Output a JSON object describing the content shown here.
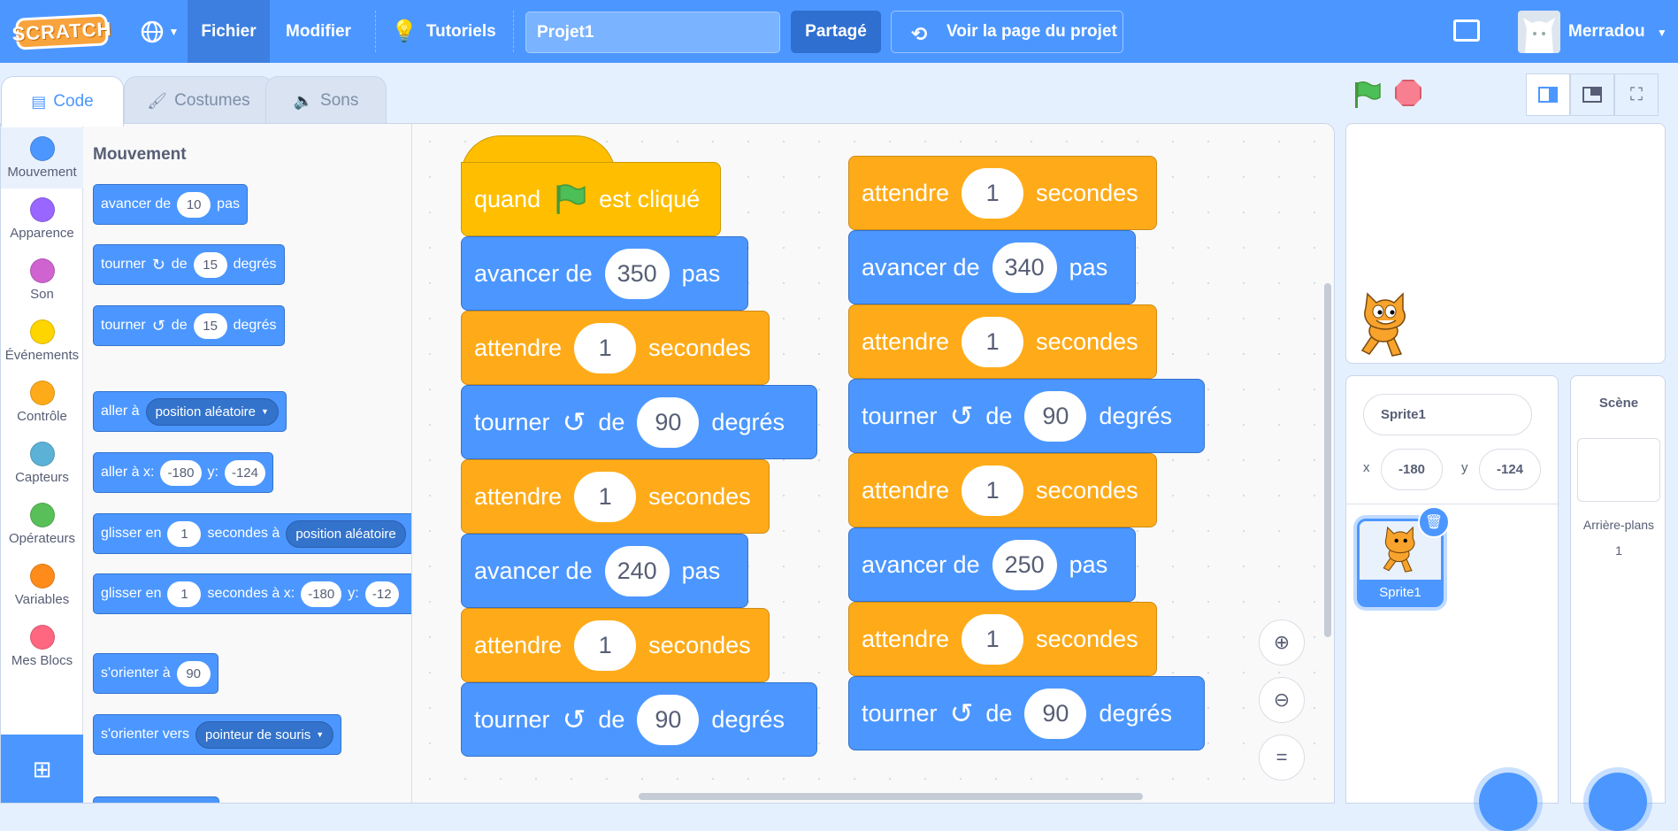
{
  "menu": {
    "logo": "SCRATCH",
    "file": "Fichier",
    "edit": "Modifier",
    "tutorials": "Tutoriels",
    "project_title": "Projet1",
    "share": "Partagé",
    "see_project": "Voir la page du projet",
    "username": "Merradou"
  },
  "tabs": {
    "code": "Code",
    "costumes": "Costumes",
    "sounds": "Sons"
  },
  "categories": [
    {
      "label": "Mouvement",
      "color": "#4c97ff"
    },
    {
      "label": "Apparence",
      "color": "#9966ff"
    },
    {
      "label": "Son",
      "color": "#cf63cf"
    },
    {
      "label": "Événements",
      "color": "#ffd500"
    },
    {
      "label": "Contrôle",
      "color": "#ffab19"
    },
    {
      "label": "Capteurs",
      "color": "#5cb1d6"
    },
    {
      "label": "Opérateurs",
      "color": "#59c059"
    },
    {
      "label": "Variables",
      "color": "#ff8c1a"
    },
    {
      "label": "Mes Blocs",
      "color": "#ff6680"
    }
  ],
  "palette": {
    "title": "Mouvement",
    "b1": {
      "t1": "avancer de",
      "v1": "10",
      "t2": "pas"
    },
    "b2": {
      "t1": "tourner",
      "t2": "de",
      "v1": "15",
      "t3": "degrés"
    },
    "b3": {
      "t1": "tourner",
      "t2": "de",
      "v1": "15",
      "t3": "degrés"
    },
    "b4": {
      "t1": "aller à",
      "d1": "position aléatoire"
    },
    "b5": {
      "t1": "aller à x:",
      "v1": "-180",
      "t2": "y:",
      "v2": "-124"
    },
    "b6": {
      "t1": "glisser en",
      "v1": "1",
      "t2": "secondes à",
      "d1": "position aléatoire"
    },
    "b7": {
      "t1": "glisser en",
      "v1": "1",
      "t2": "secondes à x:",
      "v2": "-180",
      "t3": "y:",
      "v3": "-12"
    },
    "b8": {
      "t1": "s'orienter à",
      "v1": "90"
    },
    "b9": {
      "t1": "s'orienter vers",
      "d1": "pointeur de souris"
    }
  },
  "script1": {
    "hat": {
      "t1": "quand",
      "t2": "est cliqué"
    },
    "s1": {
      "t1": "avancer de",
      "v": "350",
      "t2": "pas"
    },
    "s2": {
      "t1": "attendre",
      "v": "1",
      "t2": "secondes"
    },
    "s3": {
      "t1": "tourner",
      "t2": "de",
      "v": "90",
      "t3": "degrés"
    },
    "s4": {
      "t1": "attendre",
      "v": "1",
      "t2": "secondes"
    },
    "s5": {
      "t1": "avancer de",
      "v": "240",
      "t2": "pas"
    },
    "s6": {
      "t1": "attendre",
      "v": "1",
      "t2": "secondes"
    },
    "s7": {
      "t1": "tourner",
      "t2": "de",
      "v": "90",
      "t3": "degrés"
    }
  },
  "script2": {
    "s1": {
      "t1": "attendre",
      "v": "1",
      "t2": "secondes"
    },
    "s2": {
      "t1": "avancer de",
      "v": "340",
      "t2": "pas"
    },
    "s3": {
      "t1": "attendre",
      "v": "1",
      "t2": "secondes"
    },
    "s4": {
      "t1": "tourner",
      "t2": "de",
      "v": "90",
      "t3": "degrés"
    },
    "s5": {
      "t1": "attendre",
      "v": "1",
      "t2": "secondes"
    },
    "s6": {
      "t1": "avancer de",
      "v": "250",
      "t2": "pas"
    },
    "s7": {
      "t1": "attendre",
      "v": "1",
      "t2": "secondes"
    },
    "s8": {
      "t1": "tourner",
      "t2": "de",
      "v": "90",
      "t3": "degrés"
    }
  },
  "zoom": {
    "reset": "="
  },
  "sprite": {
    "name": "Sprite1",
    "x_label": "x",
    "x": "-180",
    "y_label": "y",
    "y": "-124",
    "thumb_name": "Sprite1"
  },
  "stage_panel": {
    "title": "Scène",
    "backdrops_label": "Arrière-plans",
    "backdrops_count": "1"
  }
}
